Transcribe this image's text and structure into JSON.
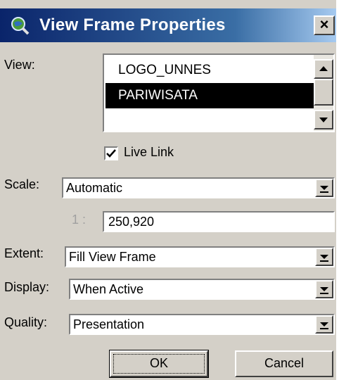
{
  "window": {
    "title": "View Frame Properties",
    "close_label": "×"
  },
  "view": {
    "label": "View:",
    "items": [
      "LOGO_UNNES",
      "PARIWISATA",
      ""
    ],
    "selected": "PARIWISATA"
  },
  "live_link": {
    "label": "Live Link",
    "checked": true
  },
  "scale": {
    "label": "Scale:",
    "value": "Automatic"
  },
  "ratio": {
    "prefix": "1 :",
    "value": "250,920"
  },
  "extent": {
    "label": "Extent:",
    "value": "Fill View Frame"
  },
  "display": {
    "label": "Display:",
    "value": "When Active"
  },
  "quality": {
    "label": "Quality:",
    "value": "Presentation"
  },
  "buttons": {
    "ok": "OK",
    "cancel": "Cancel"
  }
}
